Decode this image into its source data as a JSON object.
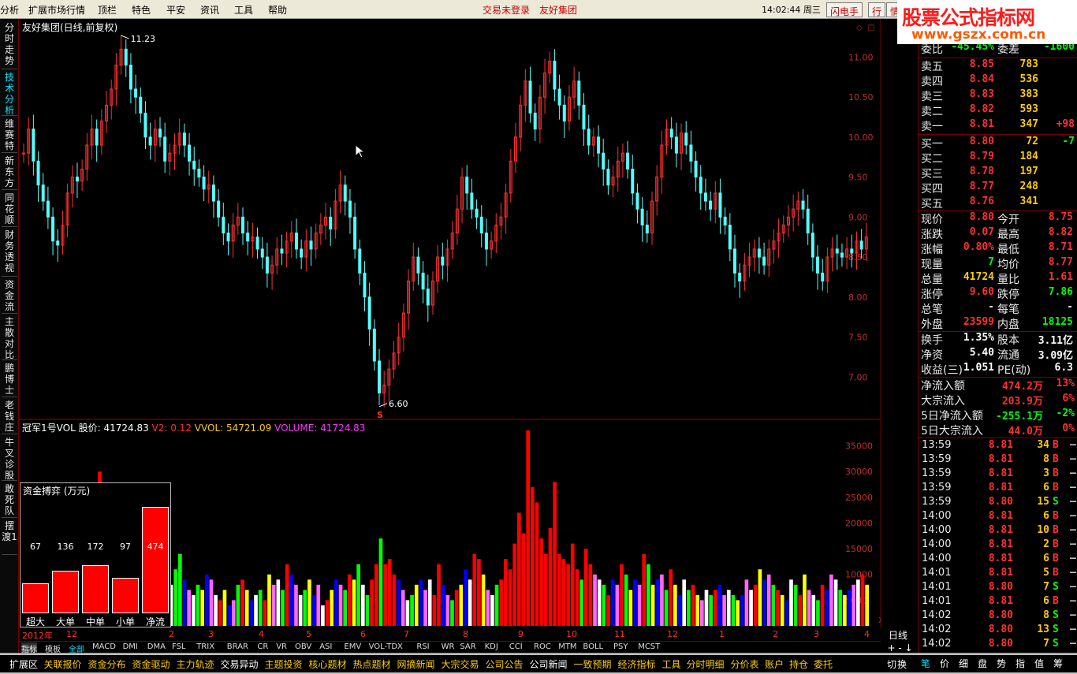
{
  "menu": [
    "分析",
    "扩展市场行情",
    "顶栏",
    "特色",
    "平安",
    "资讯",
    "工具",
    "帮助"
  ],
  "alerts": [
    "交易未登录",
    "友好集团"
  ],
  "clock": "14:02:44 周三",
  "toolbar_buttons": [
    "闪电手",
    "行",
    "情"
  ],
  "logo": {
    "text": "股票公式指标网",
    "url": "www.gszx.com.cn"
  },
  "left_tabs": [
    "分时走势",
    "技术分析",
    "维赛特",
    "新东方",
    "同花顺",
    "财务透视",
    "资金流",
    "主散对比",
    "鹏博士",
    "老钱庄",
    "牛叉诊股",
    "敢死队",
    "摆渡1"
  ],
  "chart": {
    "title": "友好集团(日线,前复权)",
    "price_high": "11.23",
    "price_low": "6.60",
    "s_marker": "S",
    "price_ticks": [
      "11.00",
      "10.50",
      "10.00",
      "9.50",
      "9.00",
      "8.50",
      "8.00",
      "7.50",
      "7.00"
    ],
    "price_range": [
      6.5,
      11.3
    ],
    "candles": [
      9.8,
      10.1,
      9.7,
      9.4,
      9.2,
      9.0,
      8.7,
      8.65,
      8.9,
      9.3,
      9.5,
      9.45,
      9.6,
      9.9,
      10.1,
      9.9,
      10.2,
      10.4,
      10.6,
      10.9,
      11.1,
      10.9,
      10.6,
      10.5,
      10.3,
      10.0,
      9.9,
      10.1,
      10.0,
      9.7,
      9.8,
      9.9,
      10.05,
      9.9,
      9.7,
      9.6,
      9.5,
      9.35,
      9.4,
      9.2,
      9.0,
      8.8,
      8.7,
      8.9,
      9.0,
      8.8,
      8.7,
      8.75,
      8.6,
      8.5,
      8.3,
      8.4,
      8.6,
      8.55,
      8.7,
      8.8,
      8.6,
      8.5,
      8.7,
      8.6,
      8.8,
      8.9,
      9.0,
      8.85,
      9.2,
      9.4,
      9.2,
      9.0,
      8.6,
      8.3,
      8.0,
      7.6,
      7.2,
      6.8,
      6.9,
      7.1,
      7.3,
      7.5,
      7.8,
      8.2,
      8.5,
      8.3,
      8.1,
      7.9,
      8.2,
      8.5,
      8.4,
      8.6,
      8.8,
      9.1,
      9.5,
      9.3,
      9.1,
      9.0,
      8.8,
      8.6,
      8.7,
      8.9,
      9.0,
      9.3,
      9.7,
      10.0,
      10.4,
      10.7,
      10.3,
      10.1,
      10.5,
      10.8,
      10.95,
      10.6,
      10.4,
      10.2,
      10.5,
      10.7,
      10.4,
      10.1,
      9.9,
      10.0,
      9.8,
      9.6,
      9.4,
      9.5,
      9.7,
      9.8,
      9.6,
      9.3,
      9.1,
      8.9,
      8.8,
      9.2,
      9.5,
      9.9,
      10.1,
      10.0,
      9.8,
      10.05,
      9.9,
      9.7,
      9.5,
      9.3,
      9.2,
      9.1,
      9.3,
      9.0,
      8.9,
      8.6,
      8.3,
      8.2,
      8.4,
      8.5,
      8.6,
      8.5,
      8.4,
      8.6,
      8.7,
      8.8,
      8.9,
      9.0,
      9.1,
      9.2,
      9.1,
      8.8,
      8.5,
      8.3,
      8.2,
      8.5,
      8.6,
      8.55,
      8.5,
      8.6,
      8.55,
      8.7,
      8.6,
      8.75
    ],
    "volume_indicator": {
      "name": "冠军1号VOL",
      "price_label": "股价: 41724.83",
      "v2": "V2: 0.12",
      "vvol": "VVOL: 54721.09",
      "volume": "VOLUME: 41724.83"
    },
    "volume_ticks": [
      "35000",
      "30000",
      "25000",
      "20000",
      "15000",
      "10000",
      "5000"
    ],
    "volume_unit": "X10",
    "volume_max": 38000,
    "volumes": [
      8,
      7,
      6,
      5,
      9,
      6,
      5,
      7,
      8,
      5,
      6,
      7,
      5,
      9,
      6,
      7,
      8,
      30,
      8,
      6,
      5,
      7,
      6,
      8,
      5,
      7,
      6,
      9,
      8,
      6,
      5,
      7,
      9,
      8,
      11,
      14,
      9,
      7,
      6,
      8,
      7,
      10,
      9,
      6,
      5,
      7,
      4,
      5,
      8,
      9,
      7,
      5,
      6,
      7,
      5,
      10,
      8,
      9,
      7,
      12,
      10,
      8,
      6,
      7,
      9,
      6,
      8,
      4,
      5,
      7,
      9,
      8,
      7,
      10,
      9,
      12,
      8,
      6,
      9,
      12,
      17,
      12,
      13,
      10,
      9,
      7,
      5,
      6,
      8,
      9,
      7,
      9,
      6,
      12,
      8,
      6,
      5,
      7,
      8,
      11,
      9,
      14,
      13,
      10,
      7,
      6,
      8,
      9,
      13,
      11,
      16,
      22,
      18,
      38,
      27,
      24,
      17,
      14,
      19,
      28,
      14,
      13,
      12,
      16,
      11,
      9,
      15,
      12,
      10,
      9,
      8,
      6,
      9,
      8,
      12,
      10,
      7,
      9,
      8,
      14,
      12,
      8,
      9,
      10,
      7,
      11,
      8,
      6,
      9,
      7,
      8,
      6,
      5,
      7,
      6,
      7,
      8,
      6,
      7,
      6,
      5,
      6,
      9,
      7,
      8,
      11,
      9,
      10,
      8,
      7,
      6,
      5,
      9,
      8,
      6,
      10,
      7,
      6,
      5,
      8,
      7,
      10,
      9,
      7,
      6,
      7,
      8,
      9,
      10,
      8
    ]
  },
  "flow_box": {
    "title": "资金搏弈 (万元)",
    "items": [
      {
        "label": "超大",
        "value": "67"
      },
      {
        "label": "大单",
        "value": "136"
      },
      {
        "label": "中单",
        "value": "172"
      },
      {
        "label": "小单",
        "value": "97"
      },
      {
        "label": "净流",
        "value": "474"
      }
    ],
    "bar_levels": [
      0.28,
      0.4,
      0.45,
      0.33,
      1.0
    ]
  },
  "date_axis": [
    "2012年",
    "12",
    "2",
    "3",
    "4",
    "5",
    "6",
    "7",
    "8",
    "9",
    "10",
    "11",
    "12",
    "1",
    "2",
    "3",
    "4"
  ],
  "right_axis_label": "日线",
  "indicator_tabs": [
    "指标",
    "模板",
    "全部",
    "MACD",
    "DMI",
    "DMA",
    "FSL",
    "TRIX",
    "BRAR",
    "CR",
    "VR",
    "OBV",
    "ASI",
    "EMV",
    "VOL-TDX",
    "RSI",
    "WR",
    "SAR",
    "KDJ",
    "CCI",
    "ROC",
    "MTM",
    "BOLL",
    "PSY",
    "MCST"
  ],
  "bottom_tabs": [
    "扩展区",
    "关联报价",
    "资金分布",
    "资金驱动",
    "主力轨迹",
    "交易异动",
    "主题投资",
    "核心题材",
    "热点题材",
    "网摘新闻",
    "大宗交易",
    "公司公告",
    "公司新闻",
    "一致预期",
    "经济指标",
    "工具",
    "分时明细",
    "分价表",
    "账户",
    "持仓",
    "委托"
  ],
  "bottom_right": [
    "切",
    "换"
  ],
  "rbottom_tabs": [
    "笔",
    "价",
    "细",
    "盘",
    "势",
    "指",
    "值",
    "筹"
  ],
  "quote": {
    "weibi": {
      "label": "委比",
      "value": "-45.45%",
      "label2": "委差",
      "value2": "-1600"
    },
    "sell": [
      {
        "label": "卖五",
        "price": "8.85",
        "vol": "783",
        "chg": ""
      },
      {
        "label": "卖四",
        "price": "8.84",
        "vol": "536",
        "chg": ""
      },
      {
        "label": "卖三",
        "price": "8.83",
        "vol": "383",
        "chg": ""
      },
      {
        "label": "卖二",
        "price": "8.82",
        "vol": "593",
        "chg": ""
      },
      {
        "label": "卖一",
        "price": "8.81",
        "vol": "347",
        "chg": "+98"
      }
    ],
    "buy": [
      {
        "label": "买一",
        "price": "8.80",
        "vol": "72",
        "chg": "-7"
      },
      {
        "label": "买二",
        "price": "8.79",
        "vol": "184",
        "chg": ""
      },
      {
        "label": "买三",
        "price": "8.78",
        "vol": "197",
        "chg": ""
      },
      {
        "label": "买四",
        "price": "8.77",
        "vol": "248",
        "chg": ""
      },
      {
        "label": "买五",
        "price": "8.76",
        "vol": "341",
        "chg": ""
      }
    ],
    "stats": [
      {
        "l1": "现价",
        "v1": "8.80",
        "c1": "#ff3030",
        "l2": "今开",
        "v2": "8.75",
        "c2": "#ff3030"
      },
      {
        "l1": "涨跌",
        "v1": "0.07",
        "c1": "#ff3030",
        "l2": "最高",
        "v2": "8.82",
        "c2": "#ff3030"
      },
      {
        "l1": "涨幅",
        "v1": "0.80%",
        "c1": "#ff3030",
        "l2": "最低",
        "v2": "8.71",
        "c2": "#ff3030"
      },
      {
        "l1": "现量",
        "v1": "7",
        "c1": "#00ff00",
        "l2": "均价",
        "v2": "8.77",
        "c2": "#ff3030"
      },
      {
        "l1": "总量",
        "v1": "41724",
        "c1": "#ffcc00",
        "l2": "量比",
        "v2": "1.61",
        "c2": "#ff3030"
      },
      {
        "l1": "涨停",
        "v1": "9.60",
        "c1": "#ff3030",
        "l2": "跌停",
        "v2": "7.86",
        "c2": "#00ff00"
      },
      {
        "l1": "总笔",
        "v1": "-",
        "c1": "#e8e8e8",
        "l2": "每笔",
        "v2": "-",
        "c2": "#e8e8e8"
      },
      {
        "l1": "外盘",
        "v1": "23599",
        "c1": "#ff3030",
        "l2": "内盘",
        "v2": "18125",
        "c2": "#00ff00"
      }
    ],
    "fund": [
      {
        "l1": "换手",
        "v1": "1.35%",
        "l2": "股本",
        "v2": "3.11亿"
      },
      {
        "l1": "净资",
        "v1": "5.40",
        "l2": "流通",
        "v2": "3.09亿"
      },
      {
        "l1": "收益(三)",
        "v1": "1.051",
        "l2": "PE(动)",
        "v2": "6.3"
      }
    ],
    "flows": [
      {
        "label": "净流入额",
        "value": "474.2万",
        "pct": "13%",
        "color": "#ff3030"
      },
      {
        "label": "大宗流入",
        "value": "203.9万",
        "pct": "6%",
        "color": "#ff3030"
      },
      {
        "label": "5日净流入额",
        "value": "-255.1万",
        "pct": "-2%",
        "color": "#00ff00"
      },
      {
        "label": "5日大宗流入",
        "value": "44.0万",
        "pct": "0%",
        "color": "#ff3030"
      }
    ],
    "ticks": [
      {
        "time": "13:59",
        "price": "8.81",
        "vol": "34",
        "dir": "B"
      },
      {
        "time": "13:59",
        "price": "8.81",
        "vol": "8",
        "dir": "B"
      },
      {
        "time": "13:59",
        "price": "8.81",
        "vol": "3",
        "dir": "B"
      },
      {
        "time": "13:59",
        "price": "8.81",
        "vol": "6",
        "dir": "B"
      },
      {
        "time": "13:59",
        "price": "8.80",
        "vol": "15",
        "dir": "S"
      },
      {
        "time": "14:00",
        "price": "8.81",
        "vol": "6",
        "dir": "B"
      },
      {
        "time": "14:00",
        "price": "8.81",
        "vol": "10",
        "dir": "B"
      },
      {
        "time": "14:00",
        "price": "8.81",
        "vol": "2",
        "dir": "B"
      },
      {
        "time": "14:00",
        "price": "8.81",
        "vol": "6",
        "dir": "B"
      },
      {
        "time": "14:01",
        "price": "8.81",
        "vol": "5",
        "dir": "B"
      },
      {
        "time": "14:01",
        "price": "8.80",
        "vol": "7",
        "dir": "S"
      },
      {
        "time": "14:01",
        "price": "8.81",
        "vol": "6",
        "dir": "B"
      },
      {
        "time": "14:02",
        "price": "8.80",
        "vol": "8",
        "dir": "S"
      },
      {
        "time": "14:02",
        "price": "8.80",
        "vol": "13",
        "dir": "S"
      },
      {
        "time": "14:02",
        "price": "8.80",
        "vol": "7",
        "dir": "S"
      }
    ]
  },
  "colors": {
    "up": "#ff3030",
    "down": "#00ff00",
    "axis": "#a00000",
    "flat": "#e8e8e8"
  }
}
